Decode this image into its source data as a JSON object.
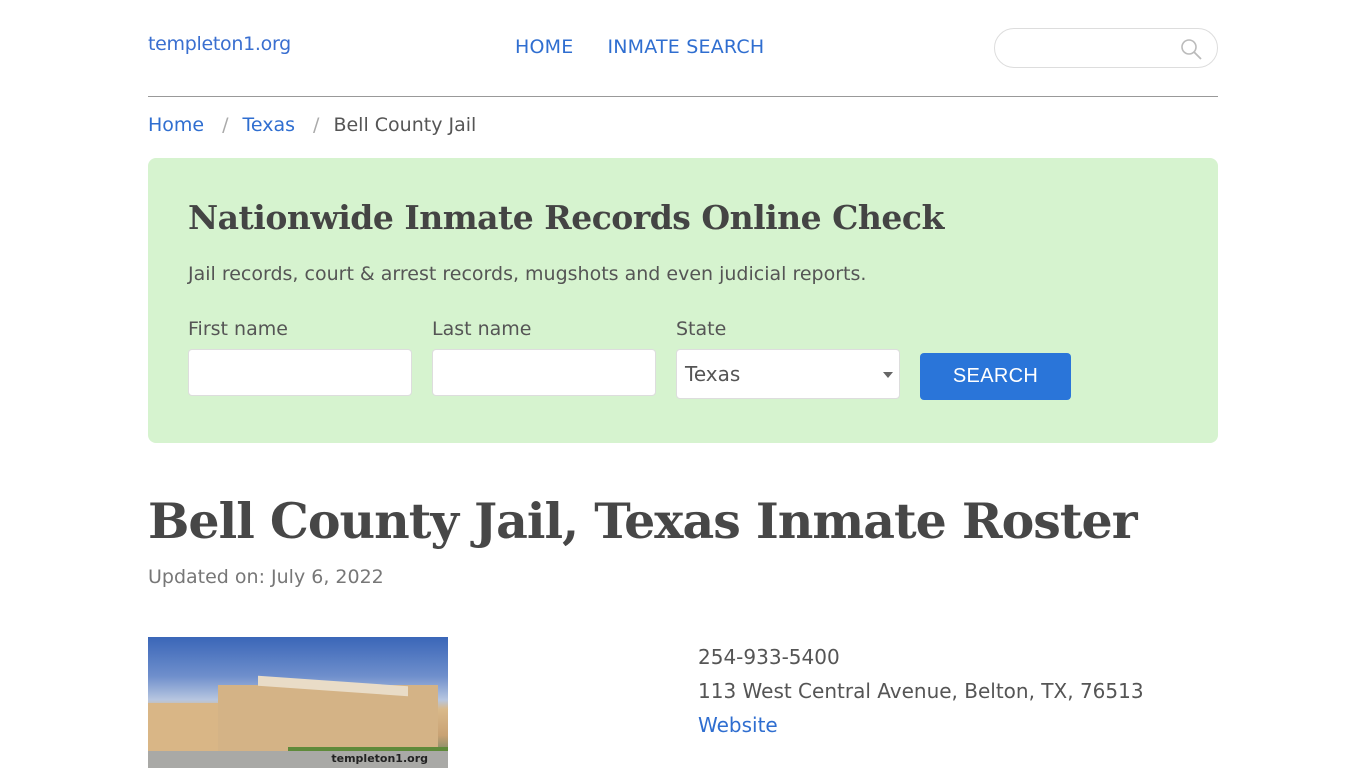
{
  "header": {
    "logo": "templeton1.org",
    "nav": [
      {
        "label": "HOME"
      },
      {
        "label": "INMATE SEARCH"
      }
    ],
    "search": {
      "placeholder": "",
      "value": ""
    }
  },
  "breadcrumb": {
    "items": [
      {
        "label": "Home"
      },
      {
        "label": "Texas"
      }
    ],
    "current": "Bell County Jail",
    "separator": "/"
  },
  "banner": {
    "title": "Nationwide Inmate Records Online Check",
    "subtitle": "Jail records, court & arrest records, mugshots and even judicial reports.",
    "first_name": {
      "label": "First name",
      "value": ""
    },
    "last_name": {
      "label": "Last name",
      "value": ""
    },
    "state": {
      "label": "State",
      "selected": "Texas"
    },
    "button": "SEARCH",
    "bg_color": "#d6f3cf",
    "button_color": "#2a75d9"
  },
  "page": {
    "title": "Bell County Jail, Texas Inmate Roster",
    "updated": "Updated on: July 6, 2022"
  },
  "facility": {
    "image_alt": "Bell County Jail building",
    "watermark": "templeton1.org",
    "phone": "254-933-5400",
    "address": "113 West Central Avenue, Belton, TX, 76513",
    "website_label": "Website"
  }
}
